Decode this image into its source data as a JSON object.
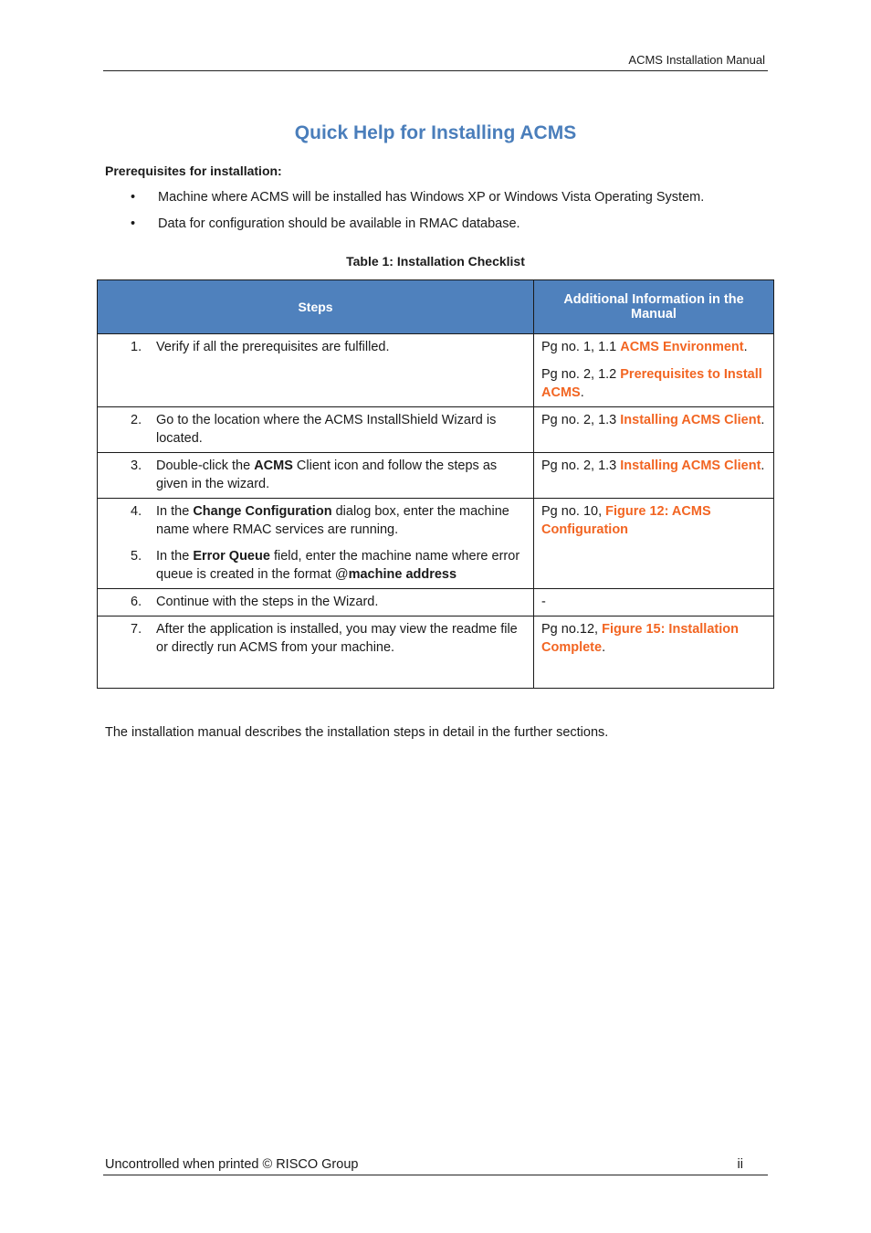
{
  "header": {
    "title": "ACMS Installation Manual"
  },
  "page_title": "Quick Help for Installing ACMS",
  "prerequisites": {
    "heading": "Prerequisites for installation:",
    "items": [
      "Machine where ACMS will be installed has Windows XP or Windows Vista Operating System.",
      "Data for configuration should be available in RMAC database."
    ]
  },
  "table": {
    "caption": "Table 1: Installation Checklist",
    "columns": [
      "Steps",
      "Additional Information in the Manual"
    ],
    "rows": [
      {
        "steps": [
          {
            "num": "1.",
            "pre": "Verify if all the prerequisites are fulfilled.",
            "bold": "",
            "post": ""
          }
        ],
        "info": [
          {
            "pre": "Pg no. 1, 1.1 ",
            "link": "ACMS Environment",
            "post": "."
          },
          {
            "pre": "Pg no. 2, 1.2 ",
            "link": "Prerequisites to Install ACMS",
            "post": "."
          }
        ]
      },
      {
        "steps": [
          {
            "num": "2.",
            "pre": "Go to the location where the ACMS InstallShield Wizard is located.",
            "bold": "",
            "post": ""
          }
        ],
        "info": [
          {
            "pre": "Pg no. 2, 1.3 ",
            "link": "Installing ACMS Client",
            "post": "."
          }
        ]
      },
      {
        "steps": [
          {
            "num": "3.",
            "pre": "Double-click the ",
            "bold": "ACMS",
            "post": " Client icon and follow the steps as given in the wizard."
          }
        ],
        "info": [
          {
            "pre": "Pg no. 2, 1.3 ",
            "link": "Installing ACMS Client",
            "post": "."
          }
        ]
      },
      {
        "steps": [
          {
            "num": "4.",
            "pre": "In the ",
            "bold": "Change Configuration",
            "post": " dialog box, enter the machine name where RMAC services are running."
          },
          {
            "num": "5.",
            "pre": "In the ",
            "bold": "Error Queue",
            "post": " field, enter the machine name where error queue is created in the format @",
            "bold2": "machine address"
          }
        ],
        "info": [
          {
            "pre": "Pg no. 10, ",
            "link": "Figure 12: ACMS Configuration",
            "post": ""
          }
        ]
      },
      {
        "steps": [
          {
            "num": "6.",
            "pre": "Continue with the steps in the Wizard.",
            "bold": "",
            "post": ""
          }
        ],
        "info": [
          {
            "pre": "-",
            "link": "",
            "post": ""
          }
        ]
      },
      {
        "steps": [
          {
            "num": "7.",
            "pre": "After the application is installed, you may view the readme file or directly run ACMS from your machine.",
            "bold": "",
            "post": ""
          }
        ],
        "info": [
          {
            "pre": "Pg no.12, ",
            "link": "Figure 15: Installation Complete",
            "post": "."
          }
        ]
      }
    ]
  },
  "closing_text": "The installation manual describes the installation steps in detail in the further sections.",
  "footer": {
    "text": "Uncontrolled when printed © RISCO Group",
    "page": "ii"
  },
  "colors": {
    "title": "#4a7ebb",
    "table_header": "#4f81bd",
    "link": "#f26522"
  }
}
